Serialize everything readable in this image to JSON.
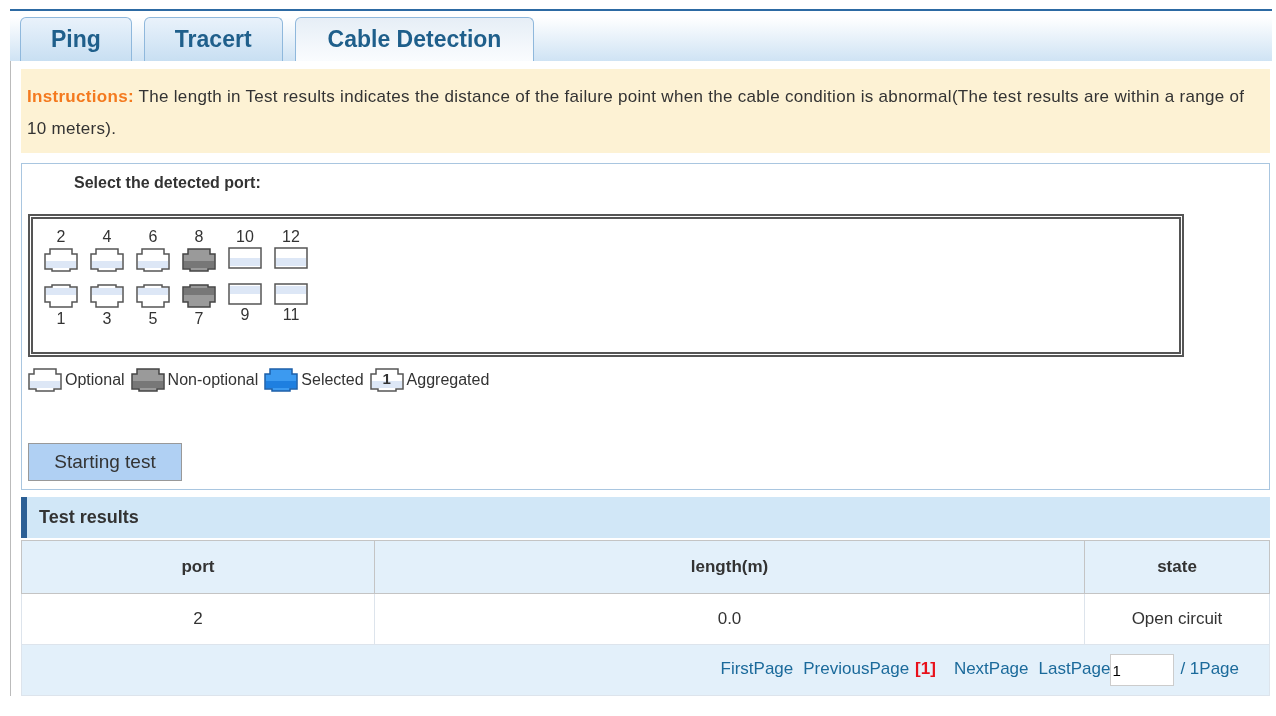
{
  "tabs": [
    {
      "label": "Ping",
      "selected": false
    },
    {
      "label": "Tracert",
      "selected": false
    },
    {
      "label": "Cable Detection",
      "selected": true
    }
  ],
  "instructions": {
    "label": "Instructions:",
    "text": "The length in Test results indicates the distance of the failure point when the cable condition is abnormal(The test results are within a range of 10 meters)."
  },
  "port_panel": {
    "title": "Select the detected port:",
    "top_row": [
      {
        "number": "2",
        "kind": "rj45",
        "disabled": false
      },
      {
        "number": "4",
        "kind": "rj45",
        "disabled": false
      },
      {
        "number": "6",
        "kind": "rj45",
        "disabled": false
      },
      {
        "number": "8",
        "kind": "rj45",
        "disabled": true
      },
      {
        "number": "10",
        "kind": "sfp",
        "disabled": false
      },
      {
        "number": "12",
        "kind": "sfp",
        "disabled": false
      }
    ],
    "bottom_row": [
      {
        "number": "1",
        "kind": "rj45",
        "disabled": false
      },
      {
        "number": "3",
        "kind": "rj45",
        "disabled": false
      },
      {
        "number": "5",
        "kind": "rj45",
        "disabled": false
      },
      {
        "number": "7",
        "kind": "rj45",
        "disabled": true
      },
      {
        "number": "9",
        "kind": "sfp",
        "disabled": false
      },
      {
        "number": "11",
        "kind": "sfp",
        "disabled": false
      }
    ],
    "legend": [
      {
        "kind": "optional",
        "label": "Optional"
      },
      {
        "kind": "nonoptional",
        "label": "Non-optional"
      },
      {
        "kind": "selected",
        "label": "Selected"
      },
      {
        "kind": "aggregated",
        "label": "Aggregated",
        "badge": "1"
      }
    ],
    "button": "Starting test"
  },
  "results": {
    "title": "Test results",
    "columns": [
      "port",
      "length(m)",
      "state"
    ],
    "rows": [
      [
        "2",
        "0.0",
        "Open circuit"
      ]
    ],
    "pager": {
      "first": "FirstPage",
      "previous": "PreviousPage",
      "current": "[1]",
      "next": "NextPage",
      "last": "LastPage",
      "page_value": "1",
      "total": "/ 1Page"
    }
  }
}
